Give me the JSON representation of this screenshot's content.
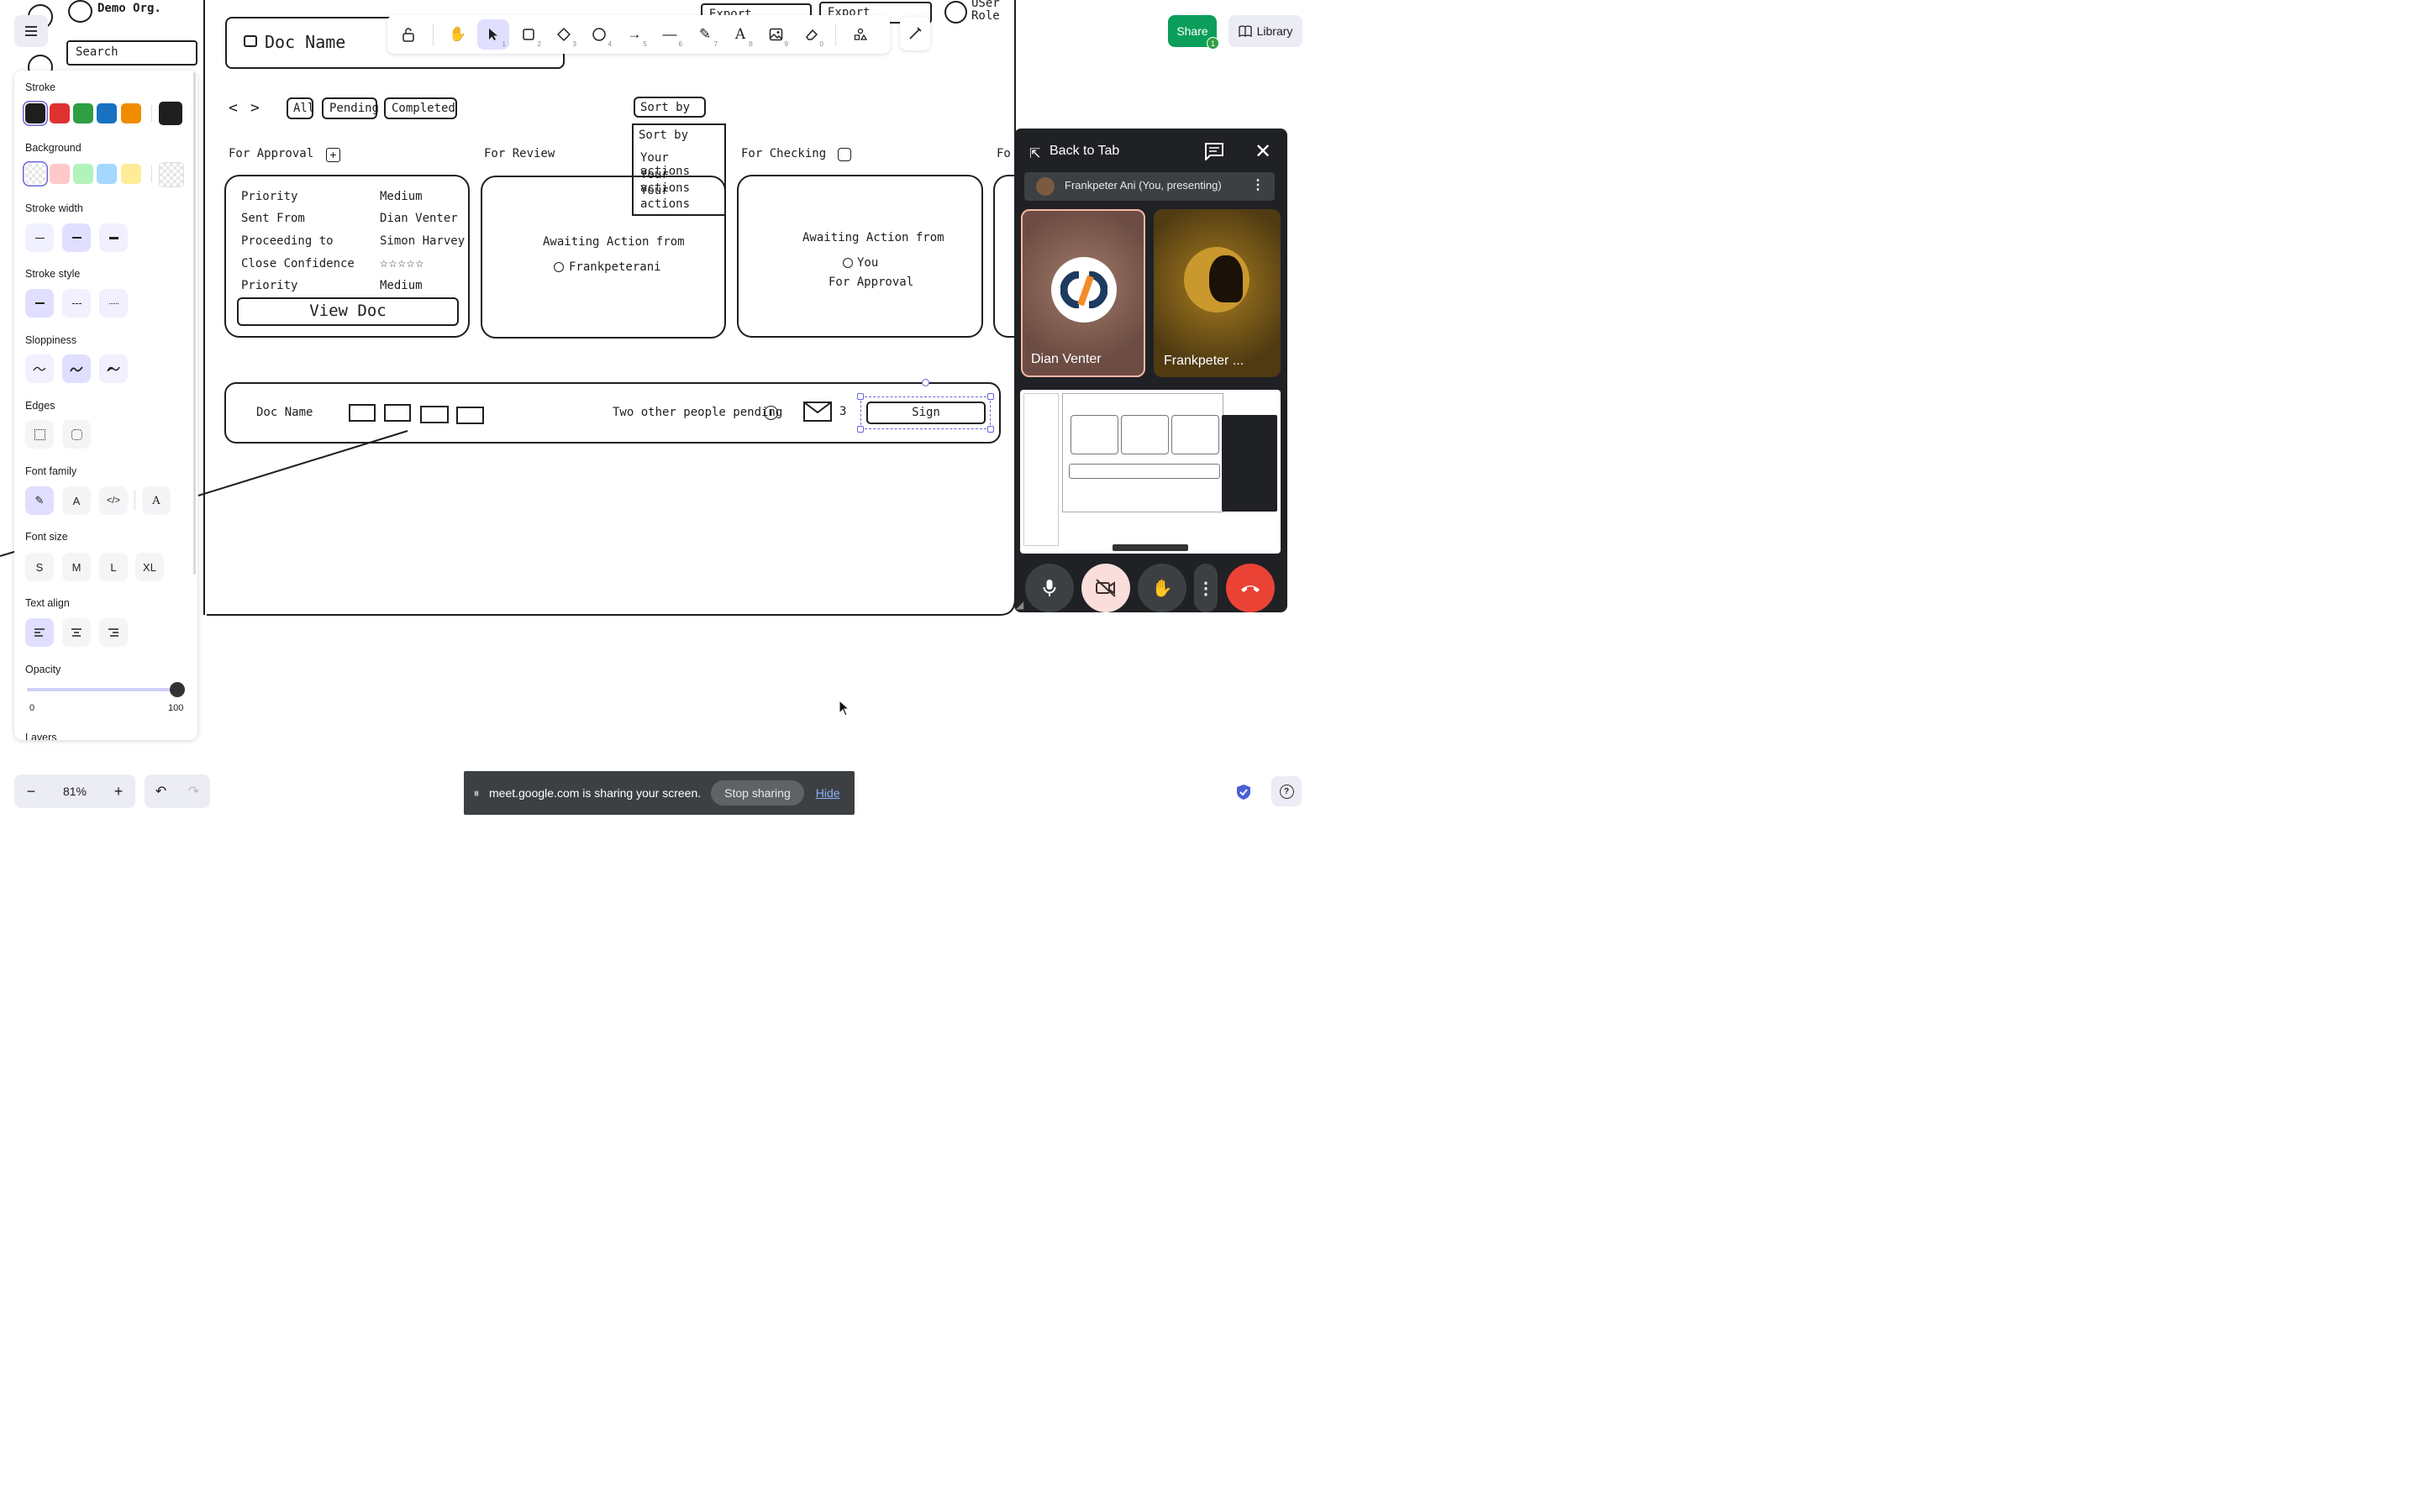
{
  "canvas": {
    "org_label": "Demo Org.",
    "search_label": "Search",
    "doc_name_title": "Doc Name",
    "export_btn_1": "Export Workflow",
    "export_btn_2": "Export Workflow",
    "user_role": "USer Role",
    "filters": [
      "All",
      "Pending",
      "Completed"
    ],
    "sort_by": "Sort by",
    "sort_menu": [
      "Sort by",
      "Your actions",
      "Your actions",
      "Your actions"
    ],
    "columns": [
      "For Approval",
      "For Review",
      "For Checking",
      "Fo"
    ],
    "approval_card": {
      "rows": [
        {
          "label": "Priority",
          "value": "Medium"
        },
        {
          "label": "Sent From",
          "value": "Dian Venter"
        },
        {
          "label": "Proceeding to",
          "value": "Simon Harvey"
        },
        {
          "label": "Close Confidence",
          "value": "☆☆☆☆☆"
        },
        {
          "label": "Priority",
          "value": "Medium"
        }
      ],
      "button": "View Doc"
    },
    "review_card": {
      "line1": "Awaiting Action from",
      "line2": "Frankpeterani"
    },
    "checking_card": {
      "line1": "Awaiting Action from",
      "line2": "You",
      "line3": "For Approval"
    },
    "bottom_bar": {
      "doc_name": "Doc Name",
      "pending": "Two other people pending",
      "mail_count": "3",
      "sign": "Sign"
    }
  },
  "toolbar": {
    "tools": [
      {
        "icon": "lock-icon",
        "num": ""
      },
      {
        "icon": "hand-icon",
        "num": ""
      },
      {
        "icon": "selection-icon",
        "num": "1"
      },
      {
        "icon": "rectangle-icon",
        "num": "2"
      },
      {
        "icon": "diamond-icon",
        "num": "3"
      },
      {
        "icon": "ellipse-icon",
        "num": "4"
      },
      {
        "icon": "arrow-icon",
        "num": "5"
      },
      {
        "icon": "line-icon",
        "num": "6"
      },
      {
        "icon": "pencil-icon",
        "num": "7"
      },
      {
        "icon": "text-icon",
        "num": "8"
      },
      {
        "icon": "image-icon",
        "num": "9"
      },
      {
        "icon": "eraser-icon",
        "num": "0"
      }
    ]
  },
  "topright": {
    "share": "Share",
    "share_badge": "1",
    "library": "Library"
  },
  "panel": {
    "stroke": "Stroke",
    "stroke_colors": [
      "#1e1e1e",
      "#e03131",
      "#2f9e44",
      "#1971c2",
      "#f08c00"
    ],
    "background": "Background",
    "bg_colors": [
      "transparent",
      "#ffc9c9",
      "#b2f2bb",
      "#a5d8ff",
      "#ffec99"
    ],
    "stroke_width": "Stroke width",
    "stroke_style": "Stroke style",
    "sloppiness": "Sloppiness",
    "edges": "Edges",
    "font_family": "Font family",
    "font_size": "Font size",
    "font_sizes": [
      "S",
      "M",
      "L",
      "XL"
    ],
    "text_align": "Text align",
    "opacity": "Opacity",
    "opacity_value": 100,
    "opacity_min": "0",
    "opacity_max": "100",
    "layers": "Layers"
  },
  "zoom": {
    "value": "81%",
    "minus": "−",
    "plus": "+"
  },
  "meet": {
    "back_to_tab": "Back to Tab",
    "presenter": "Frankpeter Ani (You, presenting)",
    "tile1": "Dian Venter",
    "tile2": "Frankpeter ..."
  },
  "share_bar": {
    "text": "meet.google.com is sharing your screen.",
    "stop": "Stop sharing",
    "hide": "Hide"
  },
  "colors": {
    "accent": "#6965db",
    "share_green": "#0b9e5b",
    "selected_bg": "#e0dfff",
    "hangup": "#ea4335"
  }
}
